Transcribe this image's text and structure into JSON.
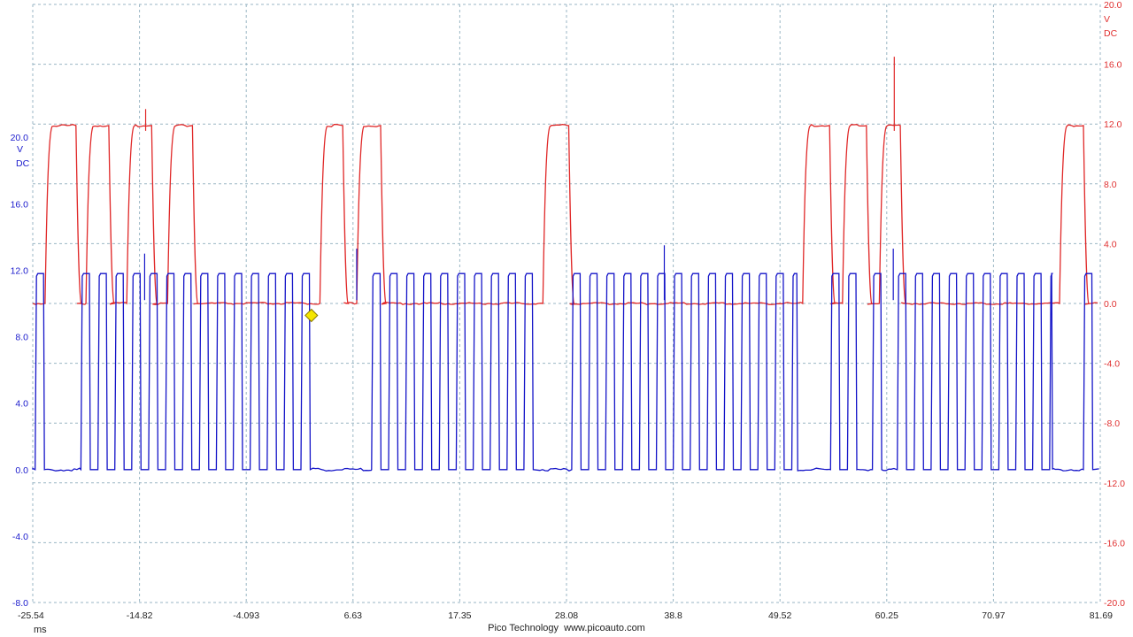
{
  "chart_data": {
    "type": "line",
    "x_axis": {
      "unit": "ms",
      "range": [
        -25.54,
        81.69
      ],
      "tick_labels": [
        "-25.54",
        "-14.82",
        "-4.093",
        "6.63",
        "17.35",
        "28.08",
        "38.8",
        "49.52",
        "60.25",
        "70.97",
        "81.69"
      ]
    },
    "left_axis": {
      "unit_lines": [
        "V",
        "DC"
      ],
      "color": "#1a1acc",
      "range": [
        -8.0,
        28.0
      ],
      "tick_labels": [
        "20.0",
        "16.0",
        "12.0",
        "8.0",
        "4.0",
        "0.0",
        "-4.0",
        "-8.0"
      ]
    },
    "right_axis": {
      "unit_lines": [
        "V",
        "DC"
      ],
      "color": "#e03030",
      "range": [
        -20.0,
        20.0
      ],
      "tick_labels": [
        "20.0",
        "16.0",
        "12.0",
        "8.0",
        "4.0",
        "0.0",
        "-4.0",
        "-8.0",
        "-12.0",
        "-16.0",
        "-20.0"
      ]
    },
    "grid": true,
    "series": [
      {
        "color": "#e02828",
        "axis": "right",
        "low": 0.0,
        "high": 11.9,
        "pulses_ms": [
          [
            -24.3,
            -21.2
          ],
          [
            -20.2,
            -17.9
          ],
          [
            -16.1,
            -13.6
          ],
          [
            -12.0,
            -9.5
          ],
          [
            3.3,
            5.6
          ],
          [
            7.0,
            9.4
          ],
          [
            25.7,
            28.3
          ],
          [
            51.8,
            54.5
          ],
          [
            55.8,
            58.2
          ],
          [
            59.5,
            61.6
          ],
          [
            77.6,
            80.0
          ]
        ],
        "spikes": [
          [
            -14.2,
            13.0
          ],
          [
            61.0,
            16.5
          ]
        ]
      },
      {
        "color": "#1414c8",
        "axis": "left",
        "low": 0.0,
        "high": 11.8,
        "bursts_ms": [
          [
            -25.3,
            -24.3
          ],
          [
            -20.7,
            2.6
          ],
          [
            8.5,
            25.4
          ],
          [
            28.6,
            51.3
          ],
          [
            54.6,
            57.3
          ],
          [
            58.8,
            59.9
          ],
          [
            61.3,
            76.9
          ],
          [
            80.0,
            81.3
          ]
        ],
        "period_ms": 1.7,
        "spikes": [
          [
            -14.3,
            13.0
          ],
          [
            7.0,
            13.3
          ],
          [
            37.9,
            13.5
          ],
          [
            60.9,
            13.3
          ]
        ]
      }
    ],
    "marker": {
      "x_ms": 2.45,
      "y_right": -0.8,
      "color": "#f5e600"
    }
  },
  "footer": {
    "x_unit": "ms",
    "brand": "Pico Technology  www.picoauto.com"
  }
}
